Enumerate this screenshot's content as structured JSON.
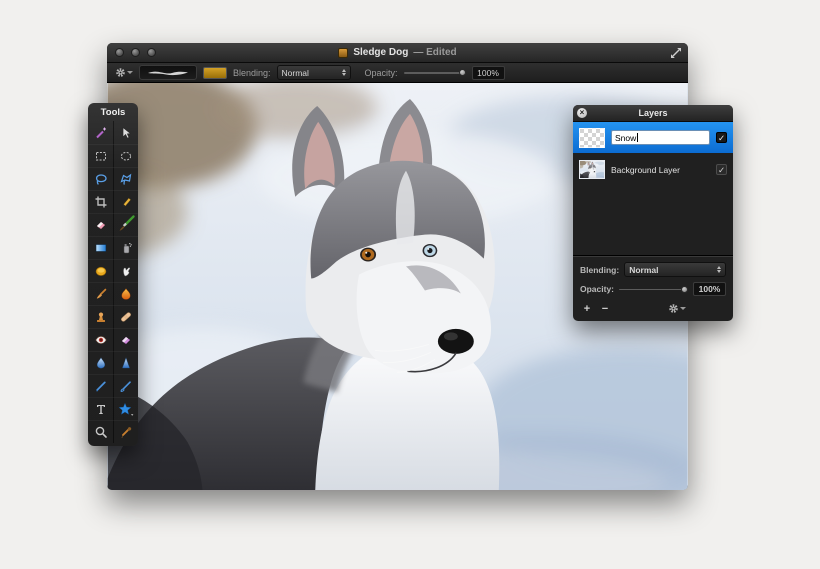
{
  "accent_color": "#1484e8",
  "main_window": {
    "titlebar": {
      "title": "Sledge Dog",
      "edited_suffix": "— Edited",
      "traffic_lights": [
        "close",
        "minimize",
        "zoom"
      ]
    },
    "toolbar": {
      "tool_settings_icon": "gear-icon",
      "brush_preview_icon": "brush-stroke-preview",
      "color_swatch_hex": "#c28d0e",
      "blending_label": "Blending:",
      "blending_value": "Normal",
      "opacity_label": "Opacity:",
      "opacity_value": "100%",
      "opacity_percent": 100
    }
  },
  "tools_palette": {
    "title": "Tools",
    "tools": [
      "magic-wand",
      "move",
      "rectangular-marquee",
      "elliptical-marquee",
      "lasso",
      "polygonal-lasso",
      "crop",
      "pencil",
      "eraser",
      "paintbrush",
      "gradient",
      "spray-can",
      "paint-bucket",
      "smudge",
      "smudge-brush",
      "burn",
      "clone-stamp",
      "healing",
      "red-eye",
      "art-eraser",
      "blur",
      "sharpen",
      "pen",
      "freeform-pen",
      "type",
      "shape",
      "zoom",
      "eyedropper"
    ]
  },
  "layers_panel": {
    "title": "Layers",
    "close_icon": "close-icon",
    "layers": [
      {
        "name": "Snow",
        "selected": true,
        "visible": true,
        "check": "✓",
        "thumbnail": "transparent-checkerboard"
      },
      {
        "name": "Background Layer",
        "selected": false,
        "visible": true,
        "check": "✓",
        "thumbnail": "husky-photo"
      }
    ],
    "blending_label": "Blending:",
    "blending_value": "Normal",
    "opacity_label": "Opacity:",
    "opacity_value": "100%",
    "opacity_percent": 100,
    "footer": {
      "add_label": "+",
      "remove_label": "−",
      "settings_icon": "gear-icon"
    }
  }
}
